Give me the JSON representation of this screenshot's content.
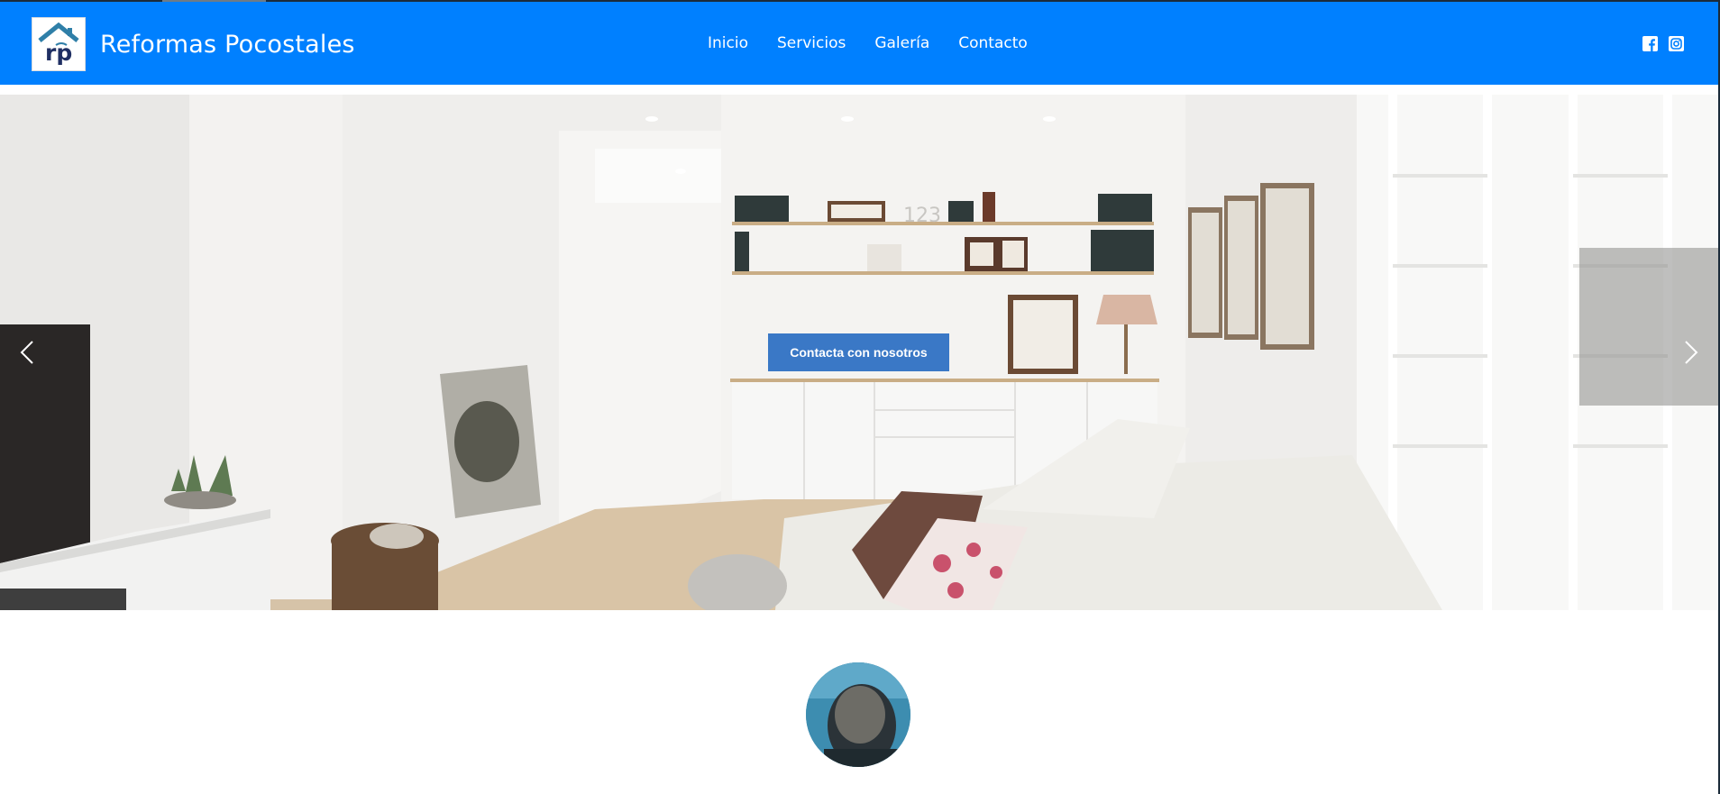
{
  "site": {
    "brand_name": "Reformas Pocostales",
    "logo_letters": "rp"
  },
  "nav": {
    "items": [
      {
        "label": "Inicio"
      },
      {
        "label": "Servicios"
      },
      {
        "label": "Galería"
      },
      {
        "label": "Contacto"
      }
    ]
  },
  "social": {
    "icons": [
      "facebook-icon",
      "instagram-icon"
    ]
  },
  "hero": {
    "cta_label": "Contacta con nosotros",
    "shelf_number": "123",
    "prev_icon": "chevron-left-icon",
    "next_icon": "chevron-right-icon"
  },
  "colors": {
    "navbar": "#0080ff",
    "cta": "#3a78c6",
    "white": "#ffffff"
  }
}
